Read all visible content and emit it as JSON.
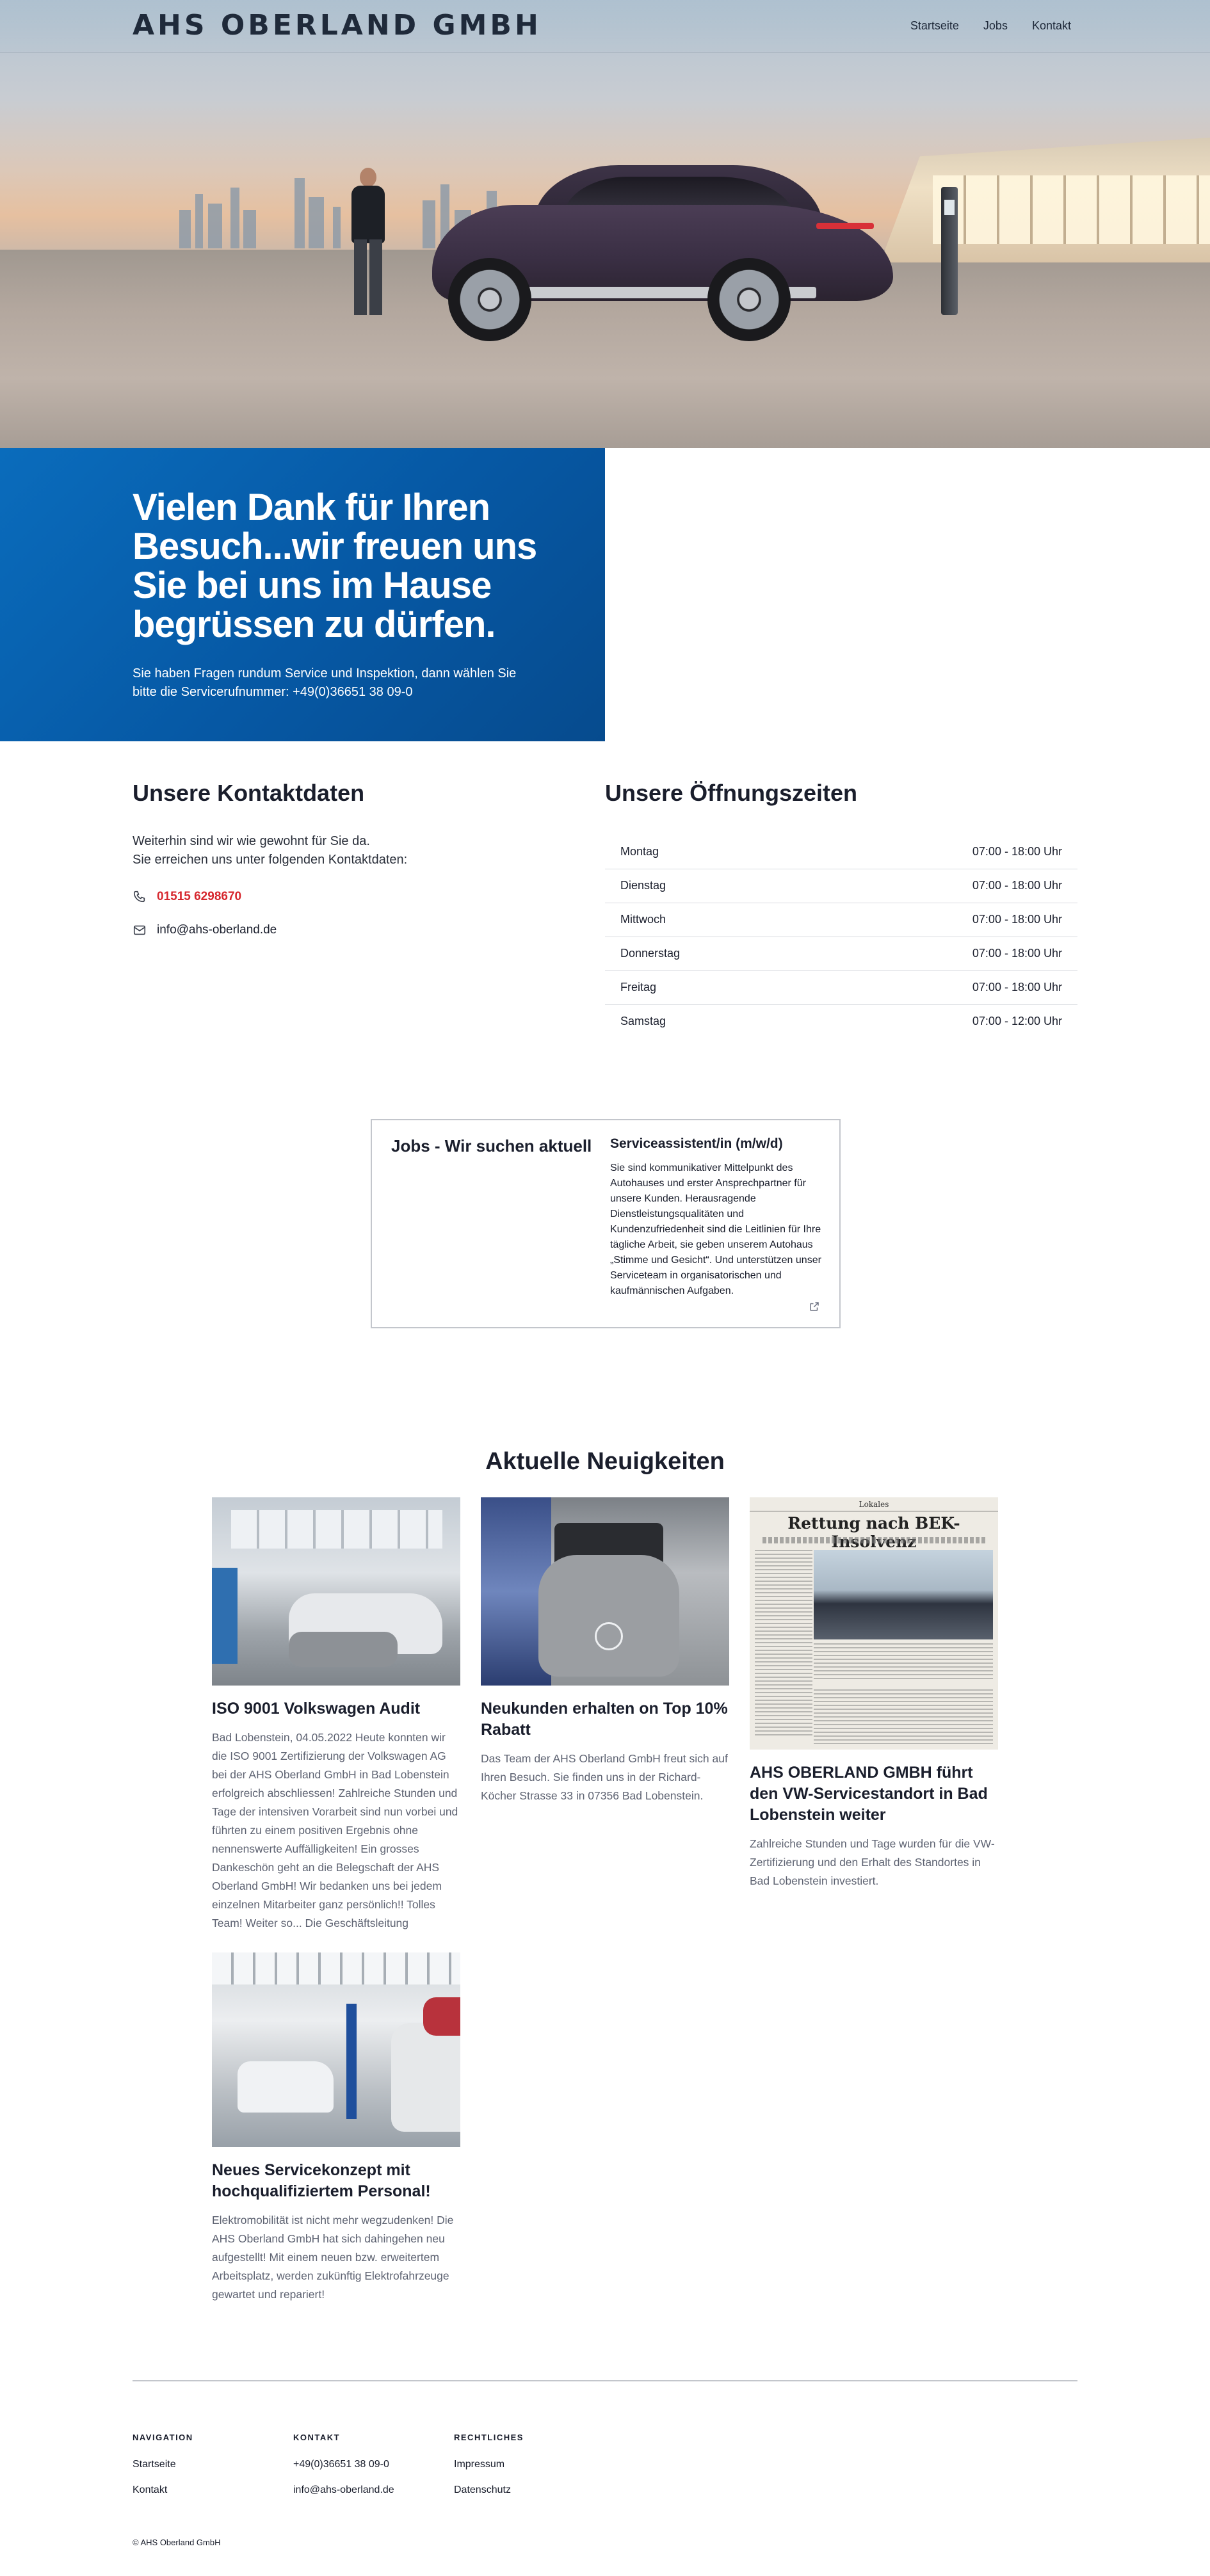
{
  "header": {
    "logo_text": "AHS OBERLAND GMBH",
    "nav": [
      "Startseite",
      "Jobs",
      "Kontakt"
    ]
  },
  "promo": {
    "headline": "Vielen Dank für Ihren Besuch...wir freuen uns Sie bei uns im Hause begrüssen zu dürfen.",
    "text": "Sie haben Fragen rundum Service und Inspektion, dann wählen Sie bitte die Servicerufnummer: +49(0)36651 38 09-0",
    "background_color": "#0660ac"
  },
  "contact": {
    "title": "Unsere Kontaktdaten",
    "intro_line1": "Weiterhin sind wir wie gewohnt für Sie da.",
    "intro_line2": "Sie erreichen uns unter folgenden Kontaktdaten:",
    "phone": "01515 6298670",
    "phone_icon": "phone-icon",
    "email": "info@ahs-oberland.de",
    "email_icon": "mail-icon",
    "accent_color": "#d6262d"
  },
  "hours": {
    "title": "Unsere Öffnungszeiten",
    "rows": [
      {
        "day": "Montag",
        "time": "07:00 - 18:00 Uhr"
      },
      {
        "day": "Dienstag",
        "time": "07:00 - 18:00 Uhr"
      },
      {
        "day": "Mittwoch",
        "time": "07:00 - 18:00 Uhr"
      },
      {
        "day": "Donnerstag",
        "time": "07:00 - 18:00 Uhr"
      },
      {
        "day": "Freitag",
        "time": "07:00 - 18:00 Uhr"
      },
      {
        "day": "Samstag",
        "time": "07:00 - 12:00 Uhr"
      }
    ]
  },
  "jobs": {
    "title": "Jobs - Wir suchen aktuell",
    "position": "Serviceassistent/in (m/w/d)",
    "description": "Sie sind kommunikativer Mittelpunkt des Autohauses und erster Ansprechpartner für unsere Kunden. Herausragende Dienstleistungsqualitäten und Kundenzufriedenheit sind die Leitlinien für Ihre tägliche Arbeit, sie geben unserem Autohaus „Stimme und Gesicht“. Und unterstützen unser Serviceteam in organisatorischen und kaufmännischen Aufgaben.",
    "link_icon": "external-link-icon"
  },
  "news": {
    "title": "Aktuelle Neuigkeiten",
    "articles": [
      {
        "title": "ISO 9001 Volkswagen Audit",
        "text": "Bad Lobenstein, 04.05.2022 Heute konnten wir die ISO 9001 Zertifizierung der Volkswagen AG bei der AHS Oberland GmbH in Bad Lobenstein erfolgreich abschliessen! Zahlreiche Stunden und Tage der intensiven Vorarbeit sind nun vorbei und führten zu einem positiven Ergebnis ohne nennenswerte Auffälligkeiten! Ein grosses Dankeschön geht an die Belegschaft der AHS Oberland GmbH! Wir bedanken uns bei jedem einzelnen Mitarbeiter ganz persönlich!! Tolles Team! Weiter so... Die Geschäftsleitung"
      },
      {
        "title": "Neukunden erhalten on Top 10% Rabatt",
        "text": "Das Team der AHS Oberland GmbH freut sich auf Ihren Besuch. Sie finden uns in der Richard-Köcher Strasse 33 in 07356 Bad Lobenstein."
      },
      {
        "title": "AHS OBERLAND GMBH führt den VW-Servicestandort in Bad Lobenstein weiter",
        "text": "Zahlreiche Stunden und Tage wurden für die VW-Zertifizierung und den Erhalt des Standortes in Bad Lobenstein investiert.",
        "image_kicker": "Lokales",
        "image_headline": "Rettung nach BEK-Insolvenz"
      },
      {
        "title": "Neues Servicekonzept mit hochqualifiziertem Personal!",
        "text": "Elektromobilität ist nicht mehr wegzudenken! Die AHS Oberland GmbH hat sich dahingehen neu aufgestellt! Mit einem neuen bzw. erweitertem Arbeitsplatz, werden zukünftig Elektrofahrzeuge gewartet und repariert!"
      }
    ]
  },
  "footer": {
    "nav_heading": "NAVIGATION",
    "nav_links": [
      "Startseite",
      "Kontakt"
    ],
    "contact_heading": "KONTAKT",
    "contact_links": [
      "+49(0)36651 38 09-0",
      "info@ahs-oberland.de"
    ],
    "legal_heading": "RECHTLICHES",
    "legal_links": [
      "Impressum",
      "Datenschutz"
    ],
    "copyright": "© AHS Oberland GmbH"
  }
}
